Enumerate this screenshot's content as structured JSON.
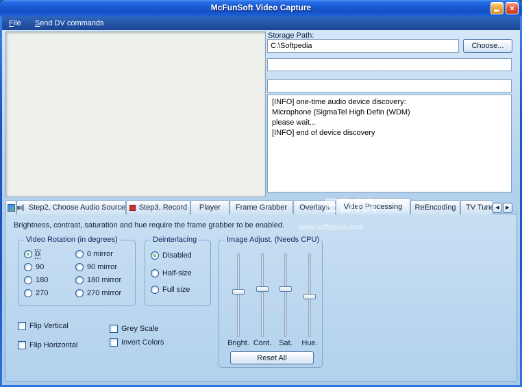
{
  "window": {
    "title": "McFunSoft Video Capture"
  },
  "icons": {
    "close": "×",
    "scroll_left": "◀",
    "scroll_right": "▶"
  },
  "menubar": {
    "items": [
      {
        "label": "File"
      },
      {
        "label": "Send DV commands"
      }
    ]
  },
  "right_panel": {
    "storage_label": "Storage Path:",
    "storage_value": "C:\\Softpedia",
    "choose_button": "Choose...",
    "field2_value": "",
    "field3_value": "",
    "log_lines": [
      "[INFO] one-time audio device discovery:",
      "Microphone (SigmaTel High Defin (WDM)",
      "please wait...",
      "[INFO] end of device discovery"
    ]
  },
  "tabs": {
    "items": [
      {
        "label": "Step2, Choose Audio Source"
      },
      {
        "label": "Step3, Record"
      },
      {
        "label": "Player"
      },
      {
        "label": "Frame Grabber"
      },
      {
        "label": "Overlays"
      },
      {
        "label": "Video Processing"
      },
      {
        "label": "ReEncoding"
      },
      {
        "label": "TV Tuner"
      }
    ],
    "selected": "Video Processing"
  },
  "panel": {
    "note": "Brightness, contrast, saturation and hue require the frame grabber to be enabled.",
    "watermark_big": "EDIA",
    "watermark_url": "www.softpedia.com",
    "rotation": {
      "title": "Video Rotation (in degrees)",
      "options": [
        "0",
        "90",
        "180",
        "270"
      ],
      "mirror_options": [
        "0  mirror",
        "90  mirror",
        "180 mirror",
        "270 mirror"
      ],
      "selected": "0"
    },
    "deinterlacing": {
      "title": "Deinterlacing",
      "options": [
        "Disabled",
        "Half-size",
        "Full size"
      ],
      "selected": "Disabled"
    },
    "image_adjust": {
      "title": "Image Adjust. (Needs CPU)",
      "sliders": [
        {
          "label": "Bright.",
          "position": 46
        },
        {
          "label": "Cont.",
          "position": 43
        },
        {
          "label": "Sat.",
          "position": 43
        },
        {
          "label": "Hue.",
          "position": 52
        }
      ],
      "reset_button": "Reset All"
    },
    "checkboxes": [
      {
        "label": "Flip Vertical",
        "checked": false
      },
      {
        "label": "Flip Horizontal",
        "checked": false
      },
      {
        "label": "Grey Scale",
        "checked": false
      },
      {
        "label": "Invert Colors",
        "checked": false
      }
    ]
  }
}
